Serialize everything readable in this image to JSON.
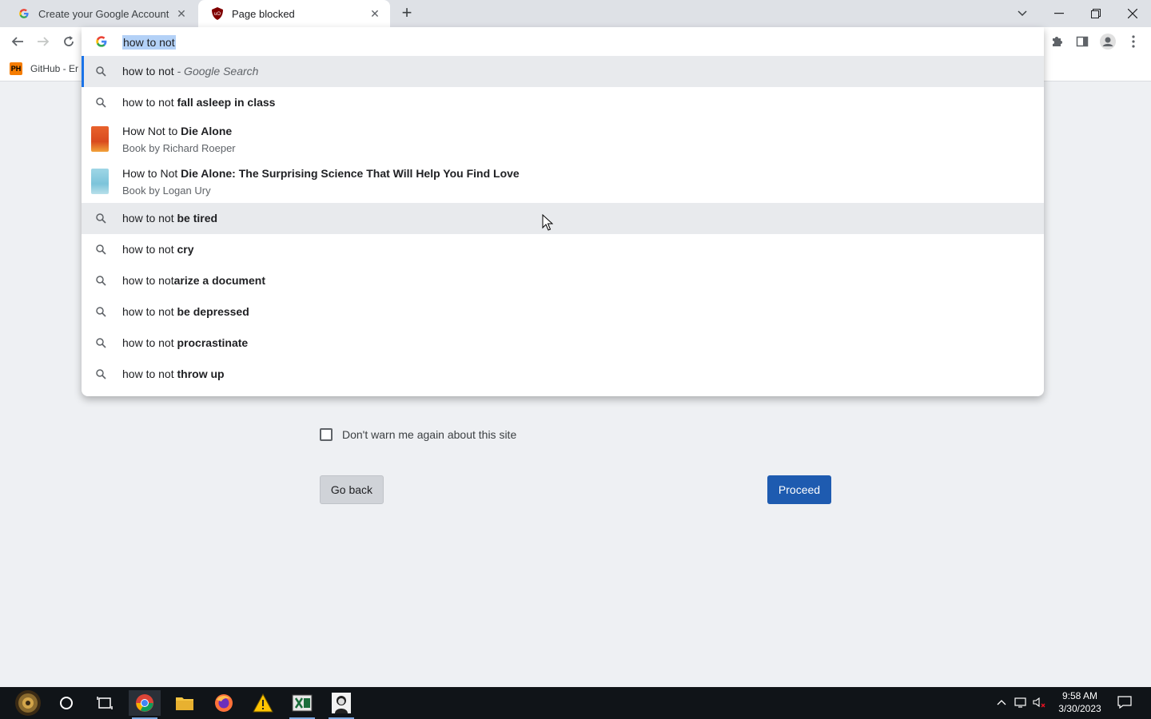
{
  "tabs": [
    {
      "title": "Create your Google Account",
      "icon": "google-g-icon",
      "active": false
    },
    {
      "title": "Page blocked",
      "icon": "ublock-shield-icon",
      "active": true
    }
  ],
  "new_tab_label": "+",
  "bookmarks": [
    {
      "label": "GitHub - Er",
      "icon": "ph-icon",
      "icon_text": "PH"
    }
  ],
  "omnibox": {
    "value": "how to not",
    "suggestions": [
      {
        "prefix": "how to not",
        "bold": "",
        "suffix": " - Google Search",
        "type": "search",
        "state": "selected"
      },
      {
        "prefix": "how to not ",
        "bold": "fall asleep in class",
        "type": "search"
      },
      {
        "prefix": "How Not to ",
        "bold": "Die Alone",
        "sub": "Book by Richard Roeper",
        "type": "book"
      },
      {
        "prefix": "How to Not ",
        "bold": "Die Alone: The Surprising Science That Will Help You Find Love",
        "sub": "Book by Logan Ury",
        "type": "book"
      },
      {
        "prefix": "how to not ",
        "bold": "be tired",
        "type": "search",
        "state": "hovered"
      },
      {
        "prefix": "how to not ",
        "bold": "cry",
        "type": "search"
      },
      {
        "prefix": "how to not",
        "bold": "arize a document",
        "type": "search"
      },
      {
        "prefix": "how to not ",
        "bold": "be depressed",
        "type": "search"
      },
      {
        "prefix": "how to not ",
        "bold": "procrastinate",
        "type": "search"
      },
      {
        "prefix": "how to not ",
        "bold": "throw up",
        "type": "search"
      }
    ]
  },
  "page": {
    "dont_warn_label": "Don't warn me again about this site",
    "go_back_label": "Go back",
    "proceed_label": "Proceed"
  },
  "taskbar": {
    "apps": [
      "start-icon",
      "cortana-icon",
      "task-view-icon",
      "chrome-icon",
      "file-explorer-icon",
      "firefox-icon",
      "warning-app-icon",
      "excel-like-icon",
      "portrait-app-icon"
    ],
    "time": "9:58 AM",
    "date": "3/30/2023"
  },
  "colors": {
    "accent": "#1a73e8",
    "proceed_bg": "#1e5bb0",
    "page_bg": "#eef0f3"
  }
}
